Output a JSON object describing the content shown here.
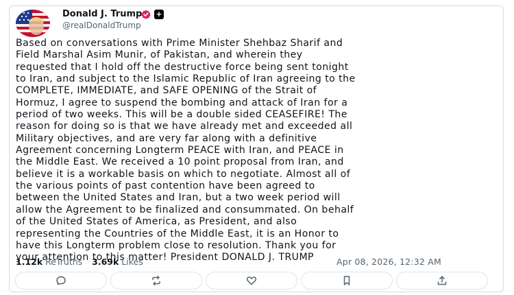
{
  "post": {
    "author_name": "Donald J. Trump",
    "author_handle": "@realDonaldTrump",
    "badge_icon": "verified-badge-icon",
    "badge_color": "#e0245e",
    "plus_label": "+",
    "body_lines": [
      "Based on conversations with Prime Minister Shehbaz Sharif and",
      "Field Marshal Asim Munir, of Pakistan, and wherein they",
      "requested that I hold off the destructive force being sent tonight",
      "to Iran, and subject to the Islamic Republic of Iran agreeing to the",
      "COMPLETE, IMMEDIATE, and SAFE OPENING of the Strait of",
      "Hormuz, I agree to suspend the bombing and attack of Iran for a",
      "period of two weeks. This will be a double sided CEASEFIRE! The",
      "reason for doing so is that we have already met and exceeded all",
      "Military objectives, and are very far along with a definitive",
      "Agreement concerning Longterm PEACE with Iran, and PEACE in",
      "the Middle East. We received a 10 point proposal from Iran, and",
      "believe it is a workable basis on which to negotiate. Almost all of",
      "the various points of past contention have been agreed to",
      "between the United States and Iran, but a two week period will",
      "allow the Agreement to be finalized and consummated. On behalf",
      "of the United States of America, as President, and also",
      "representing the Countries of the Middle East, it is an Honor to",
      "have this Longterm problem close to resolution. Thank you for",
      "your attention to this matter! President DONALD J. TRUMP"
    ],
    "retruths_count": "1.12k",
    "retruths_label": "ReTruths",
    "likes_count": "3.69k",
    "likes_label": "Likes",
    "timestamp": "Apr 08, 2026, 12:32 AM"
  },
  "actions": [
    {
      "name": "reply-button",
      "icon": "reply-bubble-icon"
    },
    {
      "name": "retruth-button",
      "icon": "retruth-arrows-icon"
    },
    {
      "name": "like-button",
      "icon": "heart-icon"
    },
    {
      "name": "bookmark-button",
      "icon": "bookmark-icon"
    },
    {
      "name": "share-button",
      "icon": "share-upload-icon"
    }
  ]
}
